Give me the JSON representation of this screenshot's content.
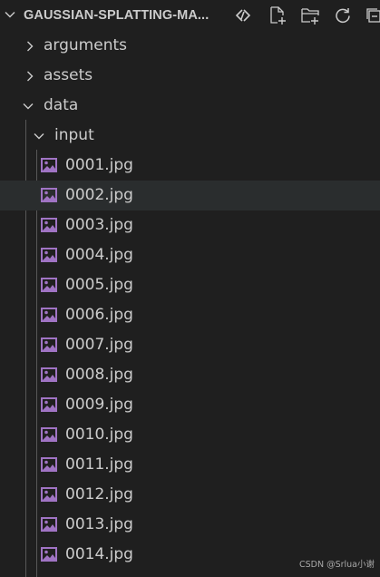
{
  "explorer": {
    "title": "GAUSSIAN-SPLATTING-MA...",
    "actions": [
      {
        "name": "connect-icon"
      },
      {
        "name": "new-file-icon"
      },
      {
        "name": "new-folder-icon"
      },
      {
        "name": "refresh-icon"
      },
      {
        "name": "collapse-all-icon"
      }
    ]
  },
  "tree": {
    "folders": [
      {
        "label": "arguments",
        "expanded": false
      },
      {
        "label": "assets",
        "expanded": false
      },
      {
        "label": "data",
        "expanded": true
      },
      {
        "label": "input",
        "expanded": true
      }
    ],
    "files": [
      "0001.jpg",
      "0002.jpg",
      "0003.jpg",
      "0004.jpg",
      "0005.jpg",
      "0006.jpg",
      "0007.jpg",
      "0008.jpg",
      "0009.jpg",
      "0010.jpg",
      "0011.jpg",
      "0012.jpg",
      "0013.jpg",
      "0014.jpg"
    ],
    "selected_file": "0002.jpg"
  },
  "colors": {
    "background": "#1f1f1f",
    "text": "#cccccc",
    "selection": "#2a2d2e",
    "image_icon": "#a074c4"
  },
  "watermark": "CSDN @Srlua小谢"
}
